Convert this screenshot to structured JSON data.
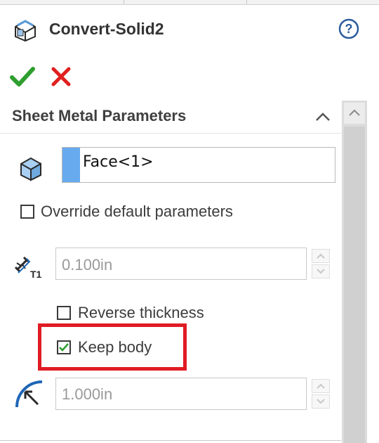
{
  "header": {
    "title": "Convert-Solid2",
    "help_symbol": "?",
    "ok_icon": "checkmark-icon",
    "cancel_icon": "x-icon"
  },
  "group": {
    "title": "Sheet Metal Parameters",
    "face_selection": "Face<1>",
    "override_label": "Override default parameters",
    "override_checked": false,
    "thickness_value": "0.100in",
    "reverse_thickness_label": "Reverse thickness",
    "reverse_thickness_checked": false,
    "keep_body_label": "Keep body",
    "keep_body_checked": true,
    "bend_radius_value": "1.000in"
  },
  "colors": {
    "ok": "#2e9e2e",
    "cancel": "#e02020",
    "selection_chip": "#68aaee",
    "highlight": "#e01b24",
    "help_icon": "#2b5d9c"
  }
}
